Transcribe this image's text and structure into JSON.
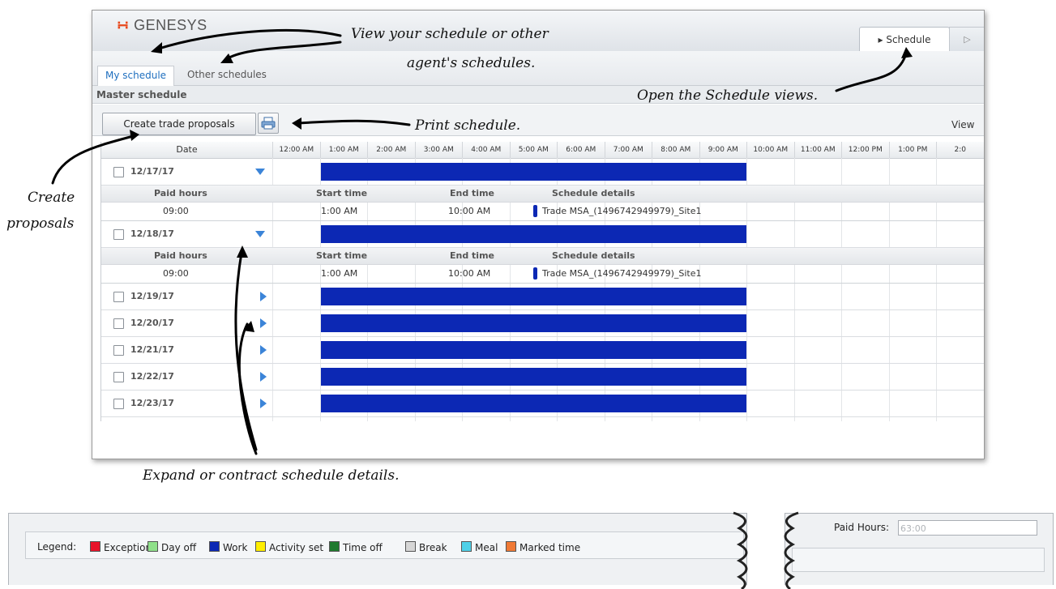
{
  "app": {
    "logo_text": "GENESYS",
    "top_tabs": [
      {
        "label": "Schedule"
      }
    ],
    "sub_tabs": [
      {
        "label": "My schedule"
      },
      {
        "label": "Other schedules"
      }
    ],
    "panel_title": "Master schedule",
    "toolbar": {
      "create_label": "Create trade proposals",
      "print_icon": "printer-icon",
      "view_label": "View"
    }
  },
  "schedule": {
    "date_header": "Date",
    "time_headers": [
      "12:00 AM",
      "1:00 AM",
      "2:00 AM",
      "3:00 AM",
      "4:00 AM",
      "5:00 AM",
      "6:00 AM",
      "7:00 AM",
      "8:00 AM",
      "9:00 AM",
      "10:00 AM",
      "11:00 AM",
      "12:00 PM",
      "1:00 PM",
      "2:0"
    ],
    "detail_headers": {
      "paid_hours": "Paid hours",
      "start_time": "Start time",
      "end_time": "End time",
      "schedule_details": "Schedule details"
    },
    "rows": [
      {
        "date": "12/17/17",
        "expanded": true,
        "work_start_hour": 1,
        "work_end_hour": 10,
        "details": {
          "paid_hours": "09:00",
          "start_time": "1:00 AM",
          "end_time": "10:00 AM",
          "activity": "Trade MSA_(1496742949979)_Site1"
        }
      },
      {
        "date": "12/18/17",
        "expanded": true,
        "work_start_hour": 1,
        "work_end_hour": 10,
        "details": {
          "paid_hours": "09:00",
          "start_time": "1:00 AM",
          "end_time": "10:00 AM",
          "activity": "Trade MSA_(1496742949979)_Site1"
        }
      },
      {
        "date": "12/19/17",
        "expanded": false,
        "work_start_hour": 1,
        "work_end_hour": 10
      },
      {
        "date": "12/20/17",
        "expanded": false,
        "work_start_hour": 1,
        "work_end_hour": 10
      },
      {
        "date": "12/21/17",
        "expanded": false,
        "work_start_hour": 1,
        "work_end_hour": 10
      },
      {
        "date": "12/22/17",
        "expanded": false,
        "work_start_hour": 1,
        "work_end_hour": 10
      },
      {
        "date": "12/23/17",
        "expanded": false,
        "work_start_hour": 1,
        "work_end_hour": 10
      }
    ],
    "work_color": "#0c28b4"
  },
  "legend": {
    "label": "Legend:",
    "items": [
      {
        "label": "Exception",
        "color": "#e8142a"
      },
      {
        "label": "Day off",
        "color": "#8fe08a"
      },
      {
        "label": "Work",
        "color": "#0c28b4"
      },
      {
        "label": "Activity set",
        "color": "#ffee00"
      },
      {
        "label": "Time off",
        "color": "#1f7a2e"
      },
      {
        "label": "Break",
        "color": "#d6d6d6"
      },
      {
        "label": "Meal",
        "color": "#4fd1e8"
      },
      {
        "label": "Marked time",
        "color": "#f07a36"
      }
    ]
  },
  "paid_hours_panel": {
    "label": "Paid Hours:",
    "value": "63:00"
  },
  "annotations": {
    "view_schedules_line1": "View your schedule or other",
    "view_schedules_line2": "agent's schedules.",
    "open_views": "Open the Schedule views.",
    "print": "Print schedule.",
    "create_line1": "Create",
    "create_line2": "proposals",
    "expand": "Expand or contract schedule details."
  }
}
